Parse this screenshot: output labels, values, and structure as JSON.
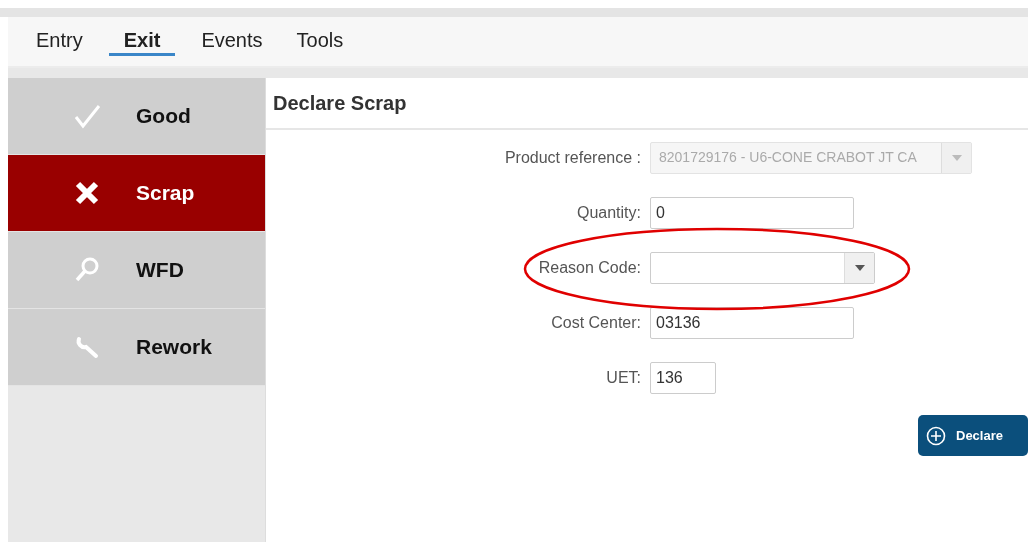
{
  "menu": [
    {
      "label": "Entry",
      "selected": false
    },
    {
      "label": "Exit",
      "selected": true
    },
    {
      "label": "Events",
      "selected": false
    },
    {
      "label": "Tools",
      "selected": false
    }
  ],
  "sidebar": {
    "items": [
      {
        "label": "Good",
        "selected": false
      },
      {
        "label": "Scrap",
        "selected": true
      },
      {
        "label": "WFD",
        "selected": false
      },
      {
        "label": "Rework",
        "selected": false
      }
    ]
  },
  "panel": {
    "title": "Declare Scrap",
    "fields": [
      {
        "label": "Product reference :",
        "kind": "select",
        "value": "8201729176 - U6-CONE CRABOT JT CA",
        "disabled": true,
        "highlighted": false
      },
      {
        "label": "Quantity:",
        "kind": "text",
        "value": "0",
        "disabled": false,
        "highlighted": false
      },
      {
        "label": "Reason Code:",
        "kind": "select",
        "disabled": false,
        "highlighted": true
      },
      {
        "label": "Cost Center:",
        "kind": "text",
        "value": "03136",
        "disabled": false,
        "highlighted": false
      },
      {
        "label": "UET:",
        "kind": "short",
        "value": "136",
        "disabled": false,
        "highlighted": false
      }
    ],
    "button": "Declare"
  }
}
